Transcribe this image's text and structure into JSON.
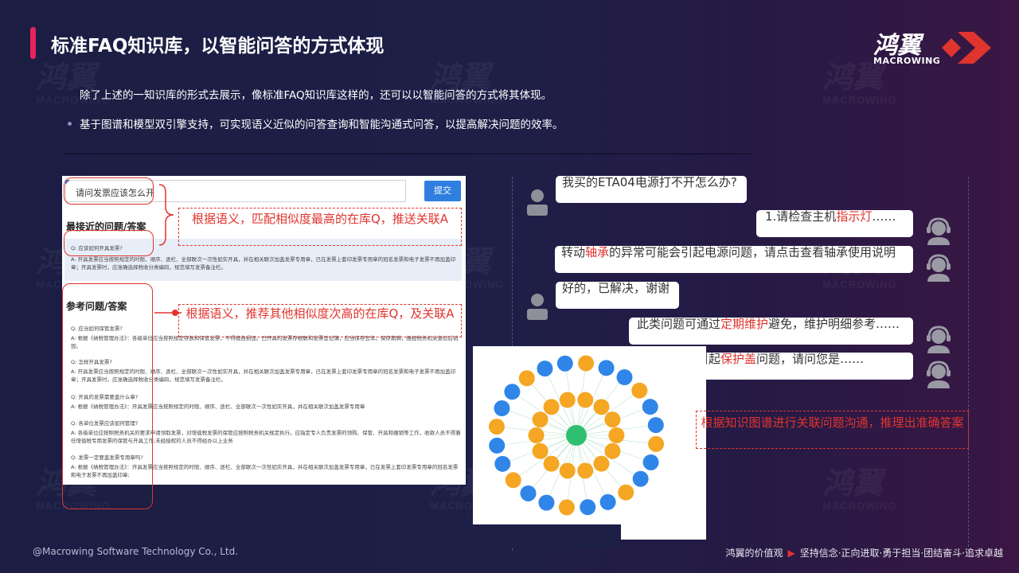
{
  "header": {
    "title": "标准FAQ知识库，以智能问答的方式体现",
    "logo_cn": "鸿翼",
    "logo_en": "MACROWING",
    "accent_color": "#e5245e"
  },
  "intro": {
    "line1": "除了上述的一知识库的形式去展示，像标准FAQ知识库这样的，还可以以智能问答的方式将其体现。",
    "line2": "基于图谱和模型双引擎支持，可实现语义近似的问答查询和智能沟通式问答，以提高解决问题的效率。"
  },
  "search_panel": {
    "query": "请问发票应该怎么开",
    "submit_label": "提交",
    "closest_heading": "最接近的问题/答案",
    "closest_q": "Q:  应该如何开具发票?",
    "closest_a": "A:  开具发票应当按照规定的时限、顺序、逐栏、全部联次一次性如实开具，并在相关联次加盖发票专用章，已在发票上套印发票专用章的冠名发票和电子发票不再加盖印章；开具发票时，应准确选择税收分类编码，规范填写发票备注栏。",
    "reference_heading": "参考问题/答案",
    "references": [
      {
        "q": "Q:  应当如何保管发票?",
        "a": "A:  根据《纳税管理办法》：各级单位应当按照规定存放和保管发票，不得擅自损毁。已开具的发票存根联和发票登记簿，应当保存五年。保存期满，报经税务机关查验后销毁。"
      },
      {
        "q": "Q:  怎样开具发票?",
        "a": "A:  开具发票应当按照规定的时限、顺序、逐栏、全部联次一次性如实开具，并在相关联次加盖发票专用章，已在发票上套印发票专用章的冠名发票和电子发票不再加盖印章；开具发票时，应准确选择税收分类编码，规范填写发票备注栏。"
      },
      {
        "q": "Q:  开具的发票需要盖什么章?",
        "a": "A:  根据《纳税管理办法》：开具发票应当按照规定的时限、顺序、逐栏、全部联次一次性如实开具，并在相关联次加盖发票专用章"
      },
      {
        "q": "Q:  各单位发票应该如何管理?",
        "a": "A:  各级单位应按照税务机关的要求申请领取发票，对增值税发票的保管应按照税务机关规定执行。应指定专人负责发票的领购、保管、开具和缴销等工作，收款人员不得兼任增值税专用发票的保管与开具工作;未经授权的人员不得经办以上业务"
      },
      {
        "q": "Q:  发票一定要盖发票专用章吗?",
        "a": "A:  根据《纳税管理办法》：开具发票应当按照规定的时限、顺序、逐栏、全部联次一次性如实开具，并在相关联次加盖发票专用章，已在发票上套印发票专用章的冠名发票和电子发票不再加盖印章;"
      }
    ]
  },
  "annotations": {
    "match": "根据语义，匹配相似度最高的在库Q，推送关联A",
    "recommend": "根据语义，推荐其他相似度次高的在库Q，及关联A",
    "graph": "根据知识图谱进行关联问题沟通，推理出准确答案"
  },
  "chat": [
    {
      "role": "user",
      "segments": [
        {
          "t": "我买的ETA04电源打不开怎么办?",
          "h": false
        }
      ]
    },
    {
      "role": "agent",
      "segments": [
        {
          "t": "1.请检查主机",
          "h": false
        },
        {
          "t": "指示灯",
          "h": true
        },
        {
          "t": "……",
          "h": false
        }
      ]
    },
    {
      "role": "agent",
      "segments": [
        {
          "t": "转动",
          "h": false
        },
        {
          "t": "轴承",
          "h": true
        },
        {
          "t": "的异常可能会引起电源问题，请点击查看",
          "h": false
        },
        {
          "t": "轴承使用说明",
          "h": false
        }
      ]
    },
    {
      "role": "user",
      "segments": [
        {
          "t": "好的，已解决，谢谢",
          "h": false
        }
      ]
    },
    {
      "role": "agent",
      "segments": [
        {
          "t": "此类问题可通过",
          "h": false
        },
        {
          "t": "定期维护",
          "h": true
        },
        {
          "t": "避免，维护明细参考……",
          "h": false
        }
      ]
    },
    {
      "role": "agent",
      "segments": [
        {
          "t": "问题一般会引起",
          "h": false
        },
        {
          "t": "保护盖",
          "h": true
        },
        {
          "t": "问题，请问您是……",
          "h": false
        }
      ]
    }
  ],
  "footer": {
    "copyright": "@Macrowing Software Technology Co., Ltd.",
    "values_label": "鸿翼的价值观",
    "values_text": "坚持信念·正向进取·勇于担当·团结奋斗·追求卓越"
  }
}
